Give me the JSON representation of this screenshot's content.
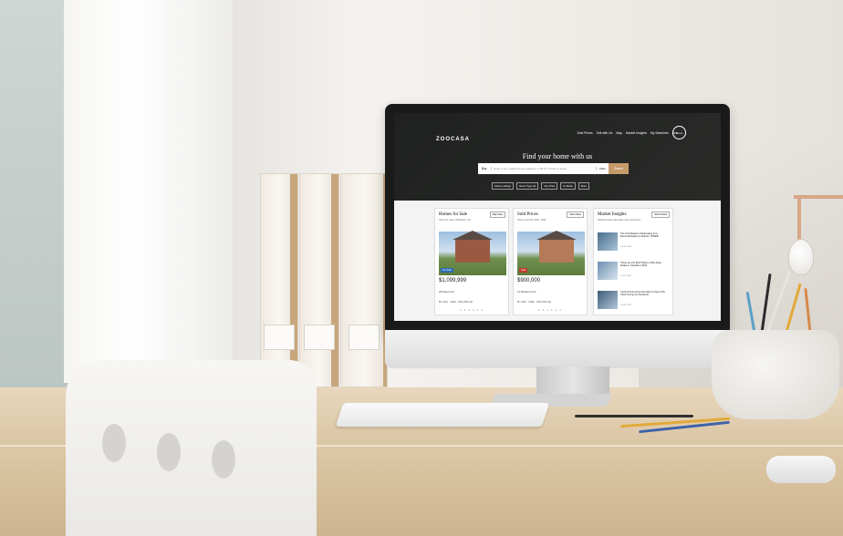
{
  "site": {
    "logo": "ZOOCASA",
    "nav": [
      "Sold Prices",
      "Sell with Us",
      "Map",
      "Market Insights",
      "My Searches",
      "Ker"
    ],
    "menu_label": "Menu",
    "hero_title": "Find your home with us",
    "search": {
      "mode": "Buy",
      "placeholder": "Enter a city, neighbourhood, address, or MLS® number or street",
      "filter_label": "Filter",
      "submit_label": "Search"
    },
    "filters": [
      "Active Listings",
      "Home Type (2)",
      "Any Price",
      "0+ Beds",
      "More"
    ]
  },
  "cards": {
    "homes": {
      "title": "Homes for Sale",
      "button": "Map View",
      "subtitle": "Homes for sale in Brampton, ON",
      "tag": "For Sale",
      "price": "$1,099,999",
      "addr": "38 Seasons Dr",
      "meta": "Bb 4 Bed  · 3 Bath  · 2000-2500 sqft"
    },
    "sold": {
      "title": "Sold Prices",
      "button": "View Cities",
      "subtitle": "Homes sold from 2021 - 2022",
      "tag": "Sold",
      "price": "$900,000",
      "addr": "12 Westlend Cres",
      "meta": "Bb 4 Bed  · 3 Bath  · 1500-2000 sqft"
    },
    "insights": {
      "title": "Market Insights",
      "button": "Show News",
      "subtitle": "Read the latest real estate news and reports",
      "articles": [
        {
          "title": "The GTA Market is Moderating from Record-Breaking to Robust: TRREB",
          "date": "Jul 08, 2022"
        },
        {
          "title": "These are the Best Places to Buy Real Estate in Canada in 2022",
          "date": "Jul 07, 2022"
        },
        {
          "title": "Condo Prices Grew the Most in these GTA Cities During the Pandemic",
          "date": "Jul 06, 2022"
        }
      ]
    },
    "dots": "● ● ● ● ● ●"
  },
  "colors": {
    "accent": "#c69a6b",
    "hero_bg": "#1f2120",
    "for_sale_tag": "#2e6fb5",
    "sold_tag": "#c0392b"
  }
}
